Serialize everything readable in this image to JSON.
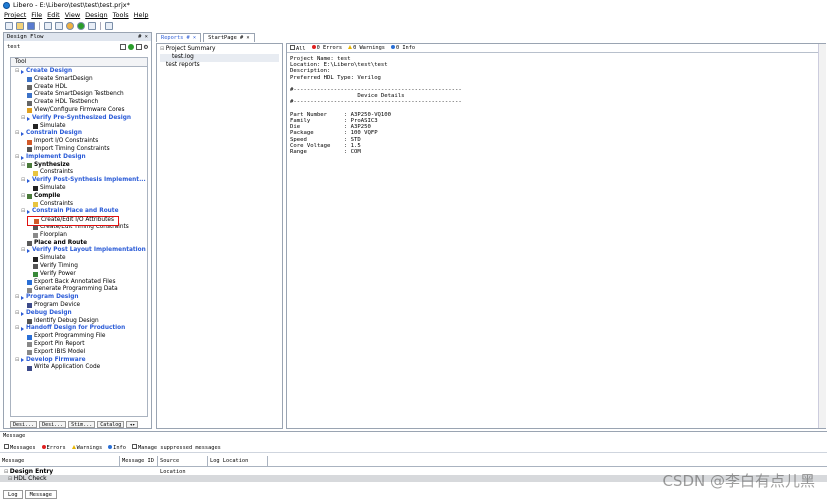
{
  "window": {
    "title": "Libero - E:\\Libero\\test\\test\\test.prjx*"
  },
  "menu": [
    "Project",
    "File",
    "Edit",
    "View",
    "Design",
    "Tools",
    "Help"
  ],
  "design_flow": {
    "header": "Design Flow",
    "pin": "# ×",
    "project": "test",
    "column_header": "Tool",
    "items": [
      {
        "label": "Create Design",
        "style": "blue-bold",
        "exp": "⊟",
        "level": 1,
        "icon": "arrow"
      },
      {
        "label": "Create SmartDesign",
        "style": "",
        "level": 2,
        "icon": "grid"
      },
      {
        "label": "Create HDL",
        "style": "",
        "level": 2,
        "icon": "doc"
      },
      {
        "label": "Create SmartDesign Testbench",
        "style": "",
        "level": 2,
        "icon": "grid"
      },
      {
        "label": "Create HDL Testbench",
        "style": "",
        "level": 2,
        "icon": "doc"
      },
      {
        "label": "View/Configure Firmware Cores",
        "style": "",
        "level": 2,
        "icon": "gear"
      },
      {
        "label": "Verify Pre-Synthesized Design",
        "style": "blue-bold",
        "exp": "⊟",
        "level": 2,
        "icon": "arrow"
      },
      {
        "label": "Simulate",
        "style": "",
        "level": 3,
        "icon": "sim"
      },
      {
        "label": "Constrain Design",
        "style": "blue-bold",
        "exp": "⊟",
        "level": 1,
        "icon": "arrow"
      },
      {
        "label": "Import I/O Constraints",
        "style": "",
        "level": 2,
        "icon": "imp"
      },
      {
        "label": "Import Timing Constraints",
        "style": "",
        "level": 2,
        "icon": "clock"
      },
      {
        "label": "Implement Design",
        "style": "blue-bold",
        "exp": "⊟",
        "level": 1,
        "icon": "arrow"
      },
      {
        "label": "Synthesize",
        "style": "bold",
        "exp": "⊟",
        "level": 2,
        "icon": "synth"
      },
      {
        "label": "Constraints",
        "style": "",
        "level": 3,
        "icon": "folder"
      },
      {
        "label": "Verify Post-Synthesis Implement...",
        "style": "blue-bold",
        "exp": "⊟",
        "level": 2,
        "icon": "arrow"
      },
      {
        "label": "Simulate",
        "style": "",
        "level": 3,
        "icon": "sim"
      },
      {
        "label": "Compile",
        "style": "bold",
        "exp": "⊟",
        "level": 2,
        "icon": "compile"
      },
      {
        "label": "Constraints",
        "style": "",
        "level": 3,
        "icon": "folder"
      },
      {
        "label": "Constrain Place and Route",
        "style": "blue-bold",
        "exp": "⊟",
        "level": 2,
        "icon": "arrow"
      },
      {
        "label": "Create/Edit I/O Attributes",
        "style": "",
        "level": 3,
        "icon": "imp",
        "highlight": true
      },
      {
        "label": "Create/Edit Timing Constraints",
        "style": "",
        "level": 3,
        "icon": "clock"
      },
      {
        "label": "Floorplan",
        "style": "",
        "level": 3,
        "icon": "floor"
      },
      {
        "label": "Place and Route",
        "style": "bold",
        "level": 2,
        "icon": "pr"
      },
      {
        "label": "Verify Post Layout Implementation",
        "style": "blue-bold",
        "exp": "⊟",
        "level": 2,
        "icon": "arrow"
      },
      {
        "label": "Simulate",
        "style": "",
        "level": 3,
        "icon": "sim"
      },
      {
        "label": "Verify Timing",
        "style": "",
        "level": 3,
        "icon": "clock"
      },
      {
        "label": "Verify Power",
        "style": "",
        "level": 3,
        "icon": "power"
      },
      {
        "label": "Export Back Annotated Files",
        "style": "",
        "level": 2,
        "icon": "exp"
      },
      {
        "label": "Generate Programming Data",
        "style": "",
        "level": 2,
        "icon": "gen"
      },
      {
        "label": "Program Design",
        "style": "blue-bold",
        "exp": "⊟",
        "level": 1,
        "icon": "arrow"
      },
      {
        "label": "Program Device",
        "style": "",
        "level": 2,
        "icon": "prog"
      },
      {
        "label": "Debug Design",
        "style": "blue-bold",
        "exp": "⊟",
        "level": 1,
        "icon": "arrow"
      },
      {
        "label": "Identify Debug Design",
        "style": "",
        "level": 2,
        "icon": "search"
      },
      {
        "label": "Handoff Design for Production",
        "style": "blue-bold",
        "exp": "⊟",
        "level": 1,
        "icon": "arrow"
      },
      {
        "label": "Export Programming File",
        "style": "",
        "level": 2,
        "icon": "exp"
      },
      {
        "label": "Export Pin Report",
        "style": "",
        "level": 2,
        "icon": "rep"
      },
      {
        "label": "Export IBIS Model",
        "style": "",
        "level": 2,
        "icon": "rep"
      },
      {
        "label": "Develop Firmware",
        "style": "blue-bold",
        "exp": "⊟",
        "level": 1,
        "icon": "arrow"
      },
      {
        "label": "Write Application Code",
        "style": "",
        "level": 2,
        "icon": "prog"
      }
    ],
    "overlay_text": "Create/Edit Timing Constraints",
    "bottom_tabs": [
      "Desi...",
      "Desi...",
      "Stim...",
      "Catalog"
    ]
  },
  "report_tabs": [
    {
      "label": "Reports  # ×",
      "active": true
    },
    {
      "label": "StartPage # ×",
      "active": false
    }
  ],
  "reports_nav": {
    "root": "Project Summary",
    "child": "test.log",
    "other": "test reports"
  },
  "report_filter": {
    "all": "All",
    "errors": "0 Errors",
    "warnings": "0 Warnings",
    "info": "0 Info"
  },
  "report_lines": [
    "Project Name: test",
    "Location: E:\\Libero\\test\\test",
    "Description:",
    "Preferred HDL Type: Verilog",
    "",
    "#--------------------------------------------------",
    "                    Device Details",
    "#--------------------------------------------------",
    "",
    "Part Number     : A3P250-VQ100",
    "Family          : ProASIC3",
    "Die             : A3P250",
    "Package         : 100 VQFP",
    "Speed           : STD",
    "Core Voltage    : 1.5",
    "Range           : COM"
  ],
  "messages": {
    "title": "Message",
    "filters": [
      "Messages",
      "Errors",
      "Warnings",
      "Info",
      "Manage suppressed messages"
    ],
    "columns": [
      "Message",
      "Message ID",
      "Source Location",
      "Log Location"
    ],
    "rows": [
      "Design Entry",
      "HDL Check"
    ],
    "bottom_tabs": [
      "Log",
      "Message"
    ]
  },
  "watermark": "CSDN @李白有点儿黑",
  "colors": {
    "accent": "#2a5bd7",
    "highlight": "#e01010",
    "error": "#e02020",
    "warning": "#e6b400",
    "info": "#2a6fd6"
  }
}
